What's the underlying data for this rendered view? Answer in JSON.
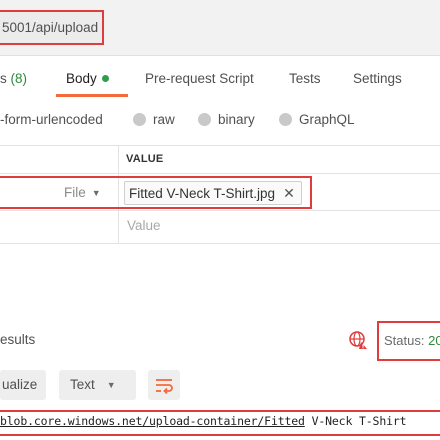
{
  "request": {
    "url_visible": "5001/api/upload"
  },
  "tabs": [
    {
      "label": "s",
      "count": "(8)"
    },
    {
      "label": "Body",
      "active": true,
      "indicator": "green-dot"
    },
    {
      "label": "Pre-request Script"
    },
    {
      "label": "Tests"
    },
    {
      "label": "Settings"
    }
  ],
  "body_modes": [
    {
      "label": "-form-urlencoded"
    },
    {
      "label": "raw"
    },
    {
      "label": "binary"
    },
    {
      "label": "GraphQL"
    }
  ],
  "table": {
    "value_header": "VALUE",
    "rows": [
      {
        "type": "File",
        "value": "Fitted V-Neck T-Shirt.jpg"
      },
      {
        "value_placeholder": "Value"
      }
    ]
  },
  "response": {
    "section_label": "esults",
    "status_label": "Status:",
    "status_code": "20",
    "view_buttons": {
      "visualize": "ualize",
      "format": "Text"
    },
    "body_link": "blob.core.windows.net/upload-container/Fitted",
    "body_rest": " V-Neck T-Shirt"
  },
  "colors": {
    "accent": "#f26b3a",
    "highlight_box": "#e03c3c",
    "success": "#2d8a3e",
    "globe_icon": "#e03c3c"
  },
  "icons": {
    "type_dropdown": "chevron-down-icon",
    "chip_remove": "close-icon",
    "network": "globe-icon",
    "format_dropdown": "chevron-down-icon",
    "wrap": "wrap-lines-icon"
  }
}
